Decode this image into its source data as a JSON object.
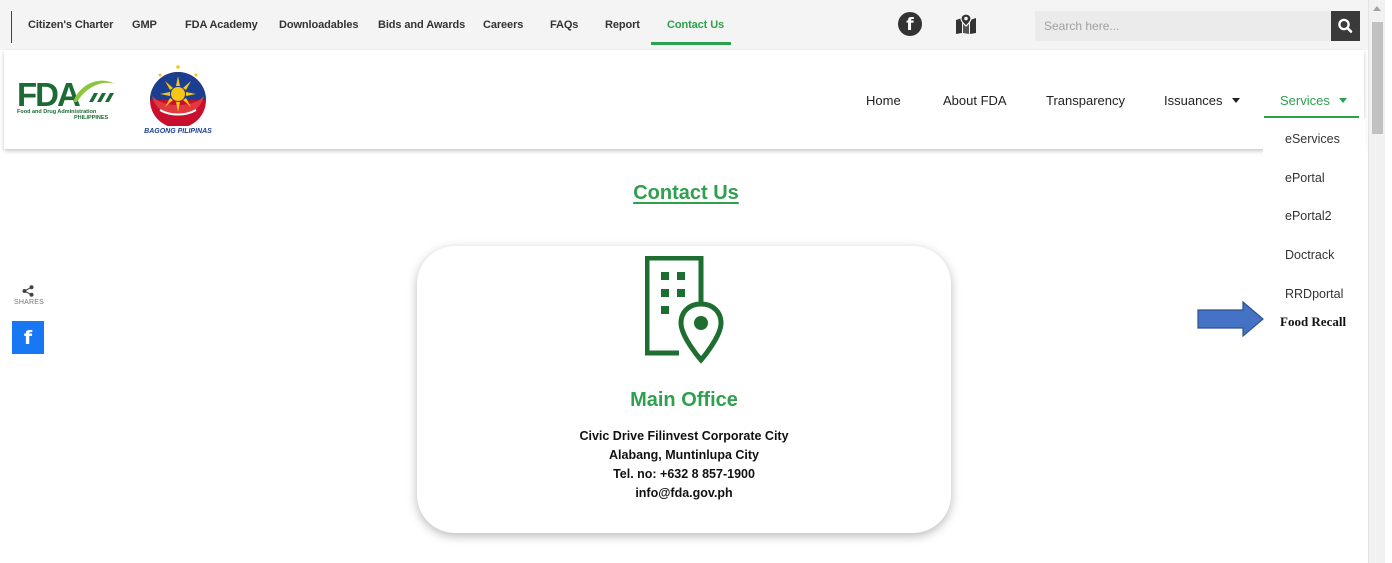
{
  "top_nav": {
    "links": [
      "Citizen's Charter",
      "GMP",
      "FDA Academy",
      "Downloadables",
      "Bids and Awards",
      "Careers",
      "FAQs",
      "Report",
      "Contact Us"
    ],
    "active": "Contact Us",
    "search_placeholder": "Search here..."
  },
  "logos": {
    "fda_text": "FDA",
    "fda_subtitle_line1": "Food and Drug Administration",
    "fda_subtitle_line2": "PHILIPPINES",
    "bagong_pilipinas": "BAGONG PILIPINAS"
  },
  "main_nav": {
    "items": [
      "Home",
      "About FDA",
      "Transparency",
      "Issuances",
      "Services"
    ],
    "active": "Services"
  },
  "services_dropdown": {
    "items": [
      "eServices",
      "ePortal",
      "ePortal2",
      "Doctrack",
      "RRDportal",
      "Food Recall"
    ],
    "highlighted": "Food Recall"
  },
  "share": {
    "label": "SHARES",
    "facebook_letter": "f"
  },
  "main": {
    "title": "Contact Us",
    "office": {
      "title": "Main Office",
      "address_line1": "Civic Drive Filinvest Corporate City",
      "address_line2": "Alabang, Muntinlupa City",
      "phone": "Tel. no: +632 8 857-1900",
      "email": "info@fda.gov.ph"
    }
  },
  "icons": {
    "facebook": "facebook-icon",
    "map": "map-location-icon",
    "search": "search-icon",
    "share": "share-icon",
    "building": "building-location-icon",
    "arrow": "right-arrow-annotation"
  },
  "colors": {
    "accent_green": "#2ea04e",
    "logo_green": "#1c6b34",
    "icon_green": "#1e6e31",
    "facebook_blue": "#1877f2",
    "arrow_blue": "#4472c4"
  }
}
